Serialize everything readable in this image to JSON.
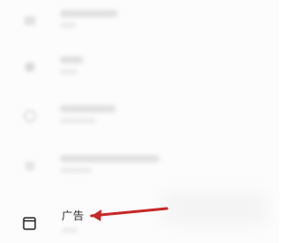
{
  "settings_list": {
    "items": [
      {
        "icon": "blurred-settings-icon"
      },
      {
        "icon": "blurred-settings-icon"
      },
      {
        "icon": "blurred-settings-icon"
      },
      {
        "icon": "blurred-settings-icon"
      },
      {
        "label": "广告",
        "icon": "window-icon"
      }
    ]
  },
  "annotation": {
    "arrow_color": "#c62828"
  }
}
